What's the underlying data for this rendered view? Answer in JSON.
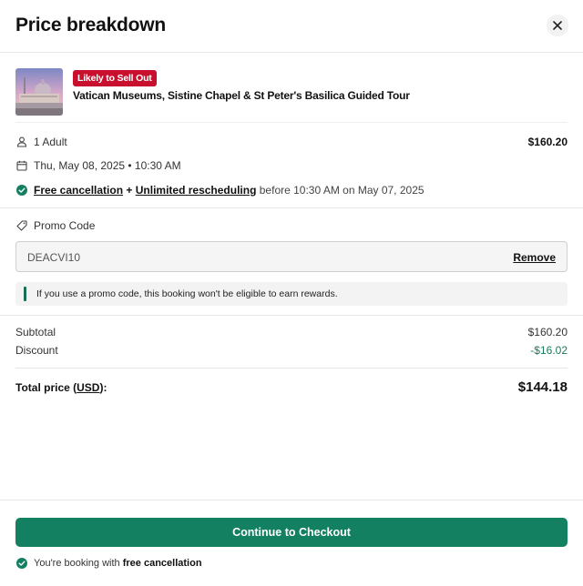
{
  "header": {
    "title": "Price breakdown"
  },
  "product": {
    "badge": "Likely to Sell Out",
    "name": "Vatican Museums, Sistine Chapel & St Peter's Basilica Guided Tour"
  },
  "booking": {
    "travelers": "1 Adult",
    "travelers_price": "$160.20",
    "datetime": "Thu, May 08, 2025 • 10:30 AM",
    "free_cancellation": "Free cancellation",
    "plus": " + ",
    "unlimited_rescheduling": "Unlimited rescheduling",
    "deadline": " before 10:30 AM on May 07, 2025"
  },
  "promo": {
    "label": "Promo Code",
    "code": "DEACVI10",
    "remove_label": "Remove",
    "notice": "If you use a promo code, this booking won't be eligible to earn rewards."
  },
  "summary": {
    "subtotal_label": "Subtotal",
    "subtotal_value": "$160.20",
    "discount_label": "Discount",
    "discount_value": "-$16.02",
    "total_label_prefix": "Total price (",
    "currency": "USD",
    "total_label_suffix": "):",
    "total_value": "$144.18"
  },
  "footer": {
    "cta_label": "Continue to Checkout",
    "note_prefix": "You're booking with ",
    "note_bold": "free cancellation"
  },
  "colors": {
    "accent": "#138062",
    "badge": "#c8102e",
    "discount": "#1b7a5a"
  }
}
